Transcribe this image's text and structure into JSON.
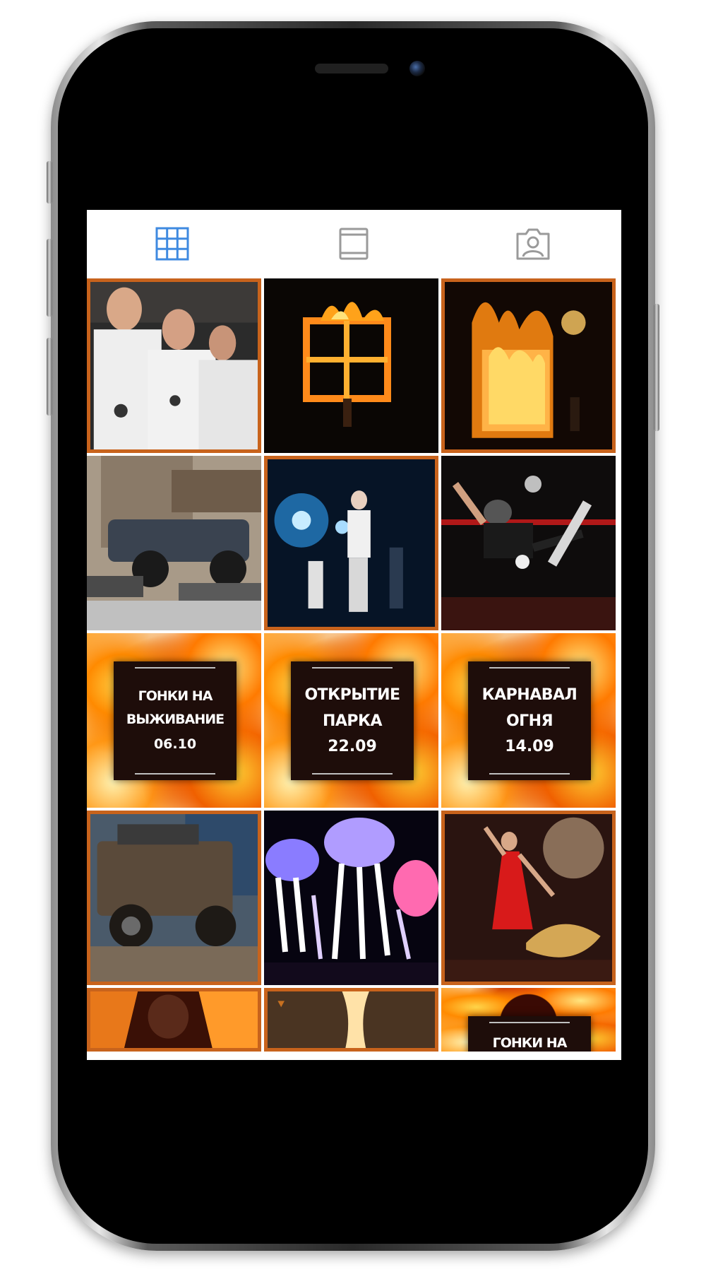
{
  "tabs": [
    {
      "name": "grid-view",
      "icon": "grid-icon",
      "active": true,
      "color": "#3f8ae0"
    },
    {
      "name": "feed-view",
      "icon": "feed-icon",
      "active": false,
      "color": "#9a9a9a"
    },
    {
      "name": "tagged-view",
      "icon": "tagged-person-icon",
      "active": false,
      "color": "#9a9a9a"
    }
  ],
  "posts": [
    {
      "kind": "photo",
      "subject": "men in white racing suits"
    },
    {
      "kind": "photo",
      "subject": "burning frame at night"
    },
    {
      "kind": "photo",
      "subject": "burning building with fire show"
    },
    {
      "kind": "photo",
      "subject": "monster truck crushing cars"
    },
    {
      "kind": "photo",
      "subject": "singer on stage with blue lights"
    },
    {
      "kind": "photo",
      "subject": "skateboarder in arena"
    },
    {
      "kind": "poster",
      "title_line1": "ГОНКИ НА",
      "title_line2": "ВЫЖИВАНИЕ",
      "date": "06.10"
    },
    {
      "kind": "poster",
      "title_line1": "ОТКРЫТИЕ",
      "title_line2": "ПАРКА",
      "date": "22.09"
    },
    {
      "kind": "poster",
      "title_line1": "КАРНАВАЛ",
      "title_line2": "ОГНЯ",
      "date": "14.09"
    },
    {
      "kind": "photo",
      "subject": "muddy off-road truck"
    },
    {
      "kind": "photo",
      "subject": "glowing jellyfish costumes parade"
    },
    {
      "kind": "photo",
      "subject": "fire dancer in red dress"
    },
    {
      "kind": "photo",
      "subject": "fire performers partially visible"
    },
    {
      "kind": "photo",
      "subject": "flame column partially visible"
    },
    {
      "kind": "poster",
      "title_line1": "ГОНКИ НА",
      "partial": true
    }
  ],
  "colors": {
    "accent": "#3f8ae0",
    "inactive_icon": "#9a9a9a",
    "tile_border": "#c8631c"
  }
}
